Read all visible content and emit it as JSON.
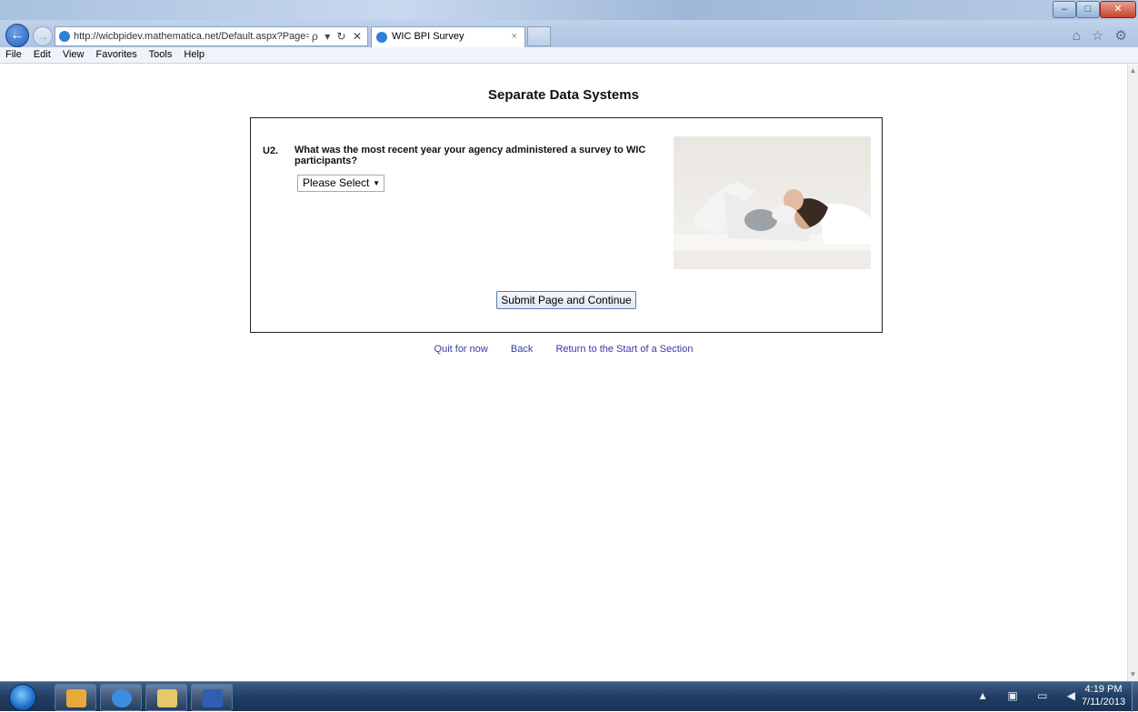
{
  "browser": {
    "address_url": "http://wicbpidev.mathematica.net/Default.aspx?Page=",
    "address_tools": "ρ ▾ ↻ ✕",
    "tab_title": "WIC BPI Survey",
    "tab_close": "×",
    "right_icons": "⌂ ☆ ⚙"
  },
  "window_controls": {
    "minimize": "–",
    "maximize": "□",
    "close": "✕"
  },
  "menu": [
    "File",
    "Edit",
    "View",
    "Favorites",
    "Tools",
    "Help"
  ],
  "page": {
    "title": "Separate Data Systems",
    "question": {
      "number": "U2.",
      "text": "What was the most recent year your agency administered a survey to WIC participants?",
      "select_value": "Please Select"
    },
    "submit_label": "Submit Page and Continue",
    "links": {
      "quit": "Quit for now",
      "back": "Back",
      "return": "Return to the Start of a Section"
    }
  },
  "taskbar": {
    "items": [
      "outlook-icon",
      "internet-explorer-icon",
      "file-explorer-icon",
      "word-icon"
    ],
    "tray_icons": "▲ ▣ ▭ ◀",
    "time": "4:19 PM",
    "date": "7/11/2013"
  },
  "colors": {
    "link": "#3a3aa8",
    "taskbar": "#213d63",
    "accent": "#1d5fbf"
  }
}
